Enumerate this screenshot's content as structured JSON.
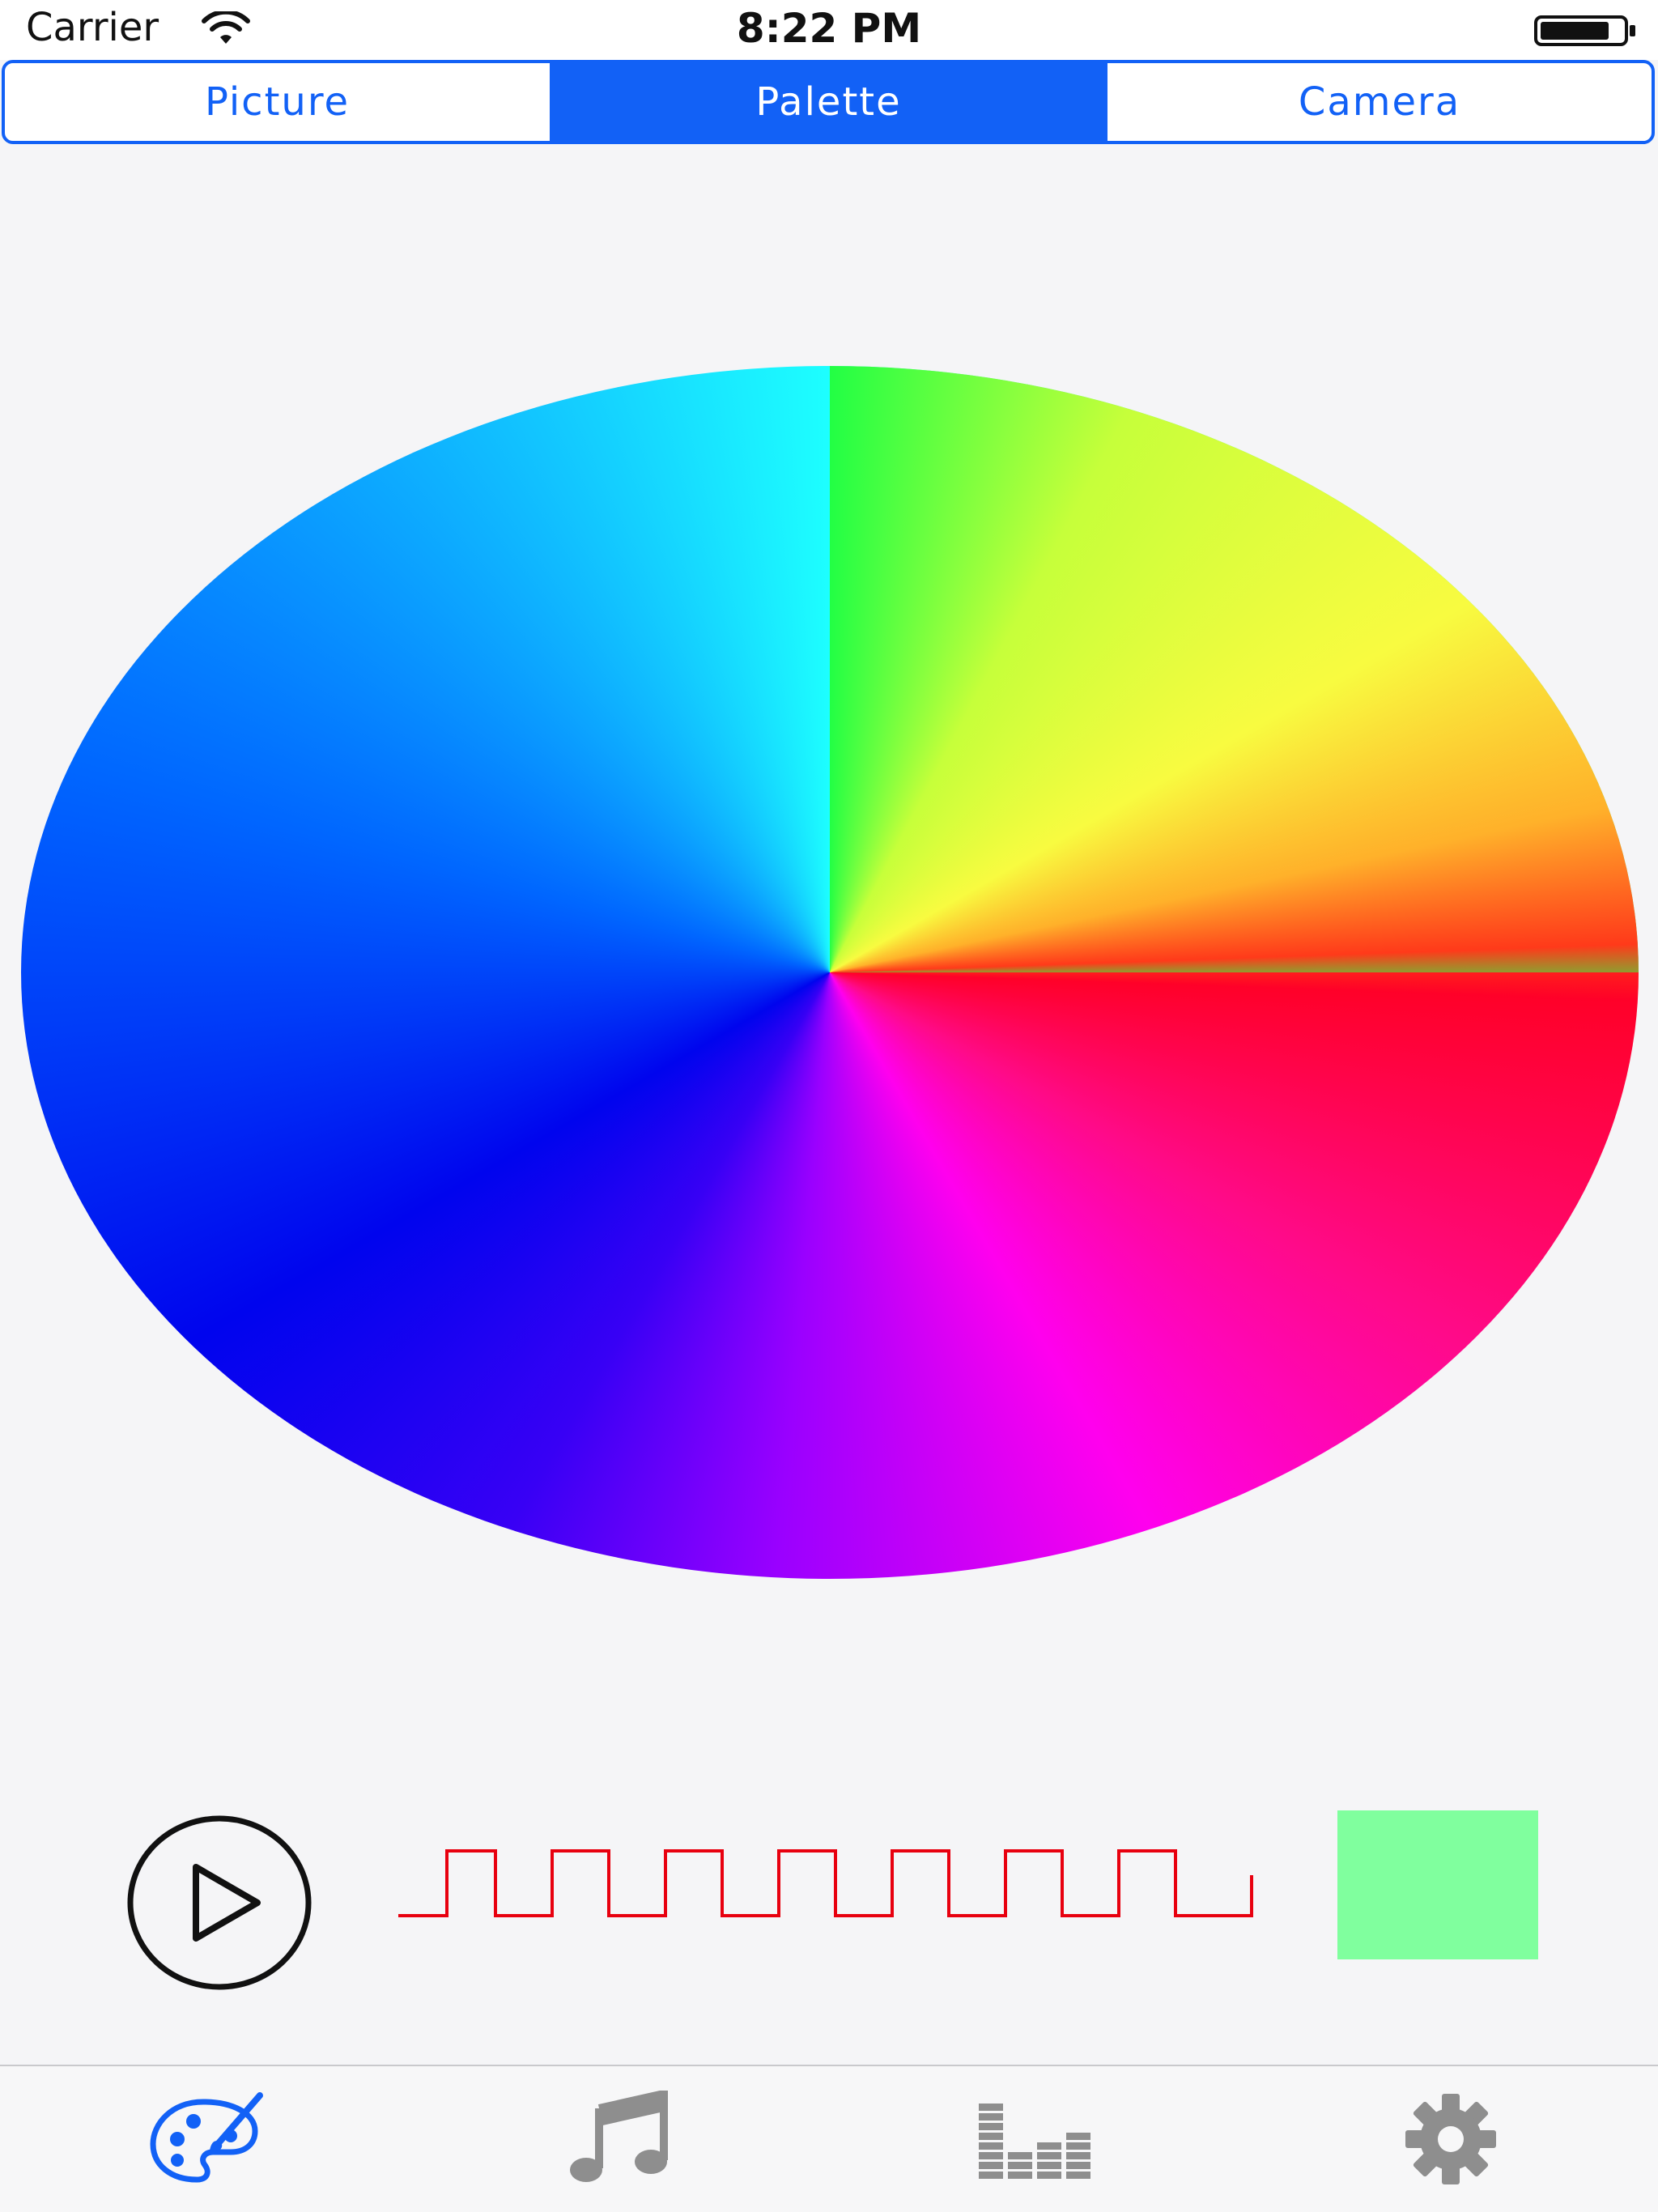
{
  "status_bar": {
    "carrier": "Carrier",
    "time": "8:22 PM"
  },
  "segmented_control": {
    "segments": [
      "Picture",
      "Palette",
      "Camera"
    ],
    "selected": "Palette",
    "accent_color": "#1261f6"
  },
  "color_wheel": {
    "type": "hue-wheel"
  },
  "controls": {
    "play_icon": "play-icon",
    "waveform_icon": "square-wave",
    "waveform_color": "#e8000f",
    "selected_color": "#80ff9e"
  },
  "tab_bar": {
    "tabs": [
      {
        "icon": "palette-icon",
        "selected": true
      },
      {
        "icon": "music-note-icon",
        "selected": false
      },
      {
        "icon": "equalizer-icon",
        "selected": false
      },
      {
        "icon": "gear-icon",
        "selected": false
      }
    ],
    "active_color": "#1261f6",
    "inactive_color": "#8e8e8e"
  }
}
